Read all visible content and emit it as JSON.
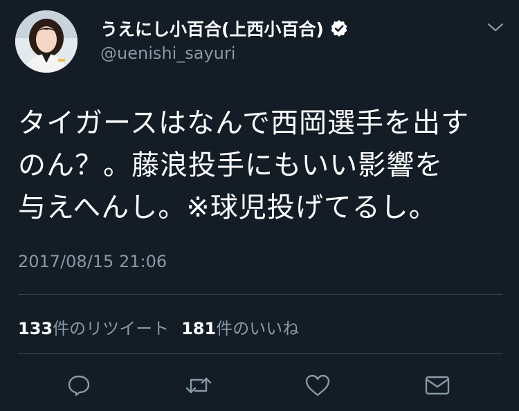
{
  "user": {
    "display_name": "うえにし小百合(上西小百合)",
    "handle": "@uenishi_sayuri",
    "verified": true
  },
  "tweet": {
    "text_lines": [
      "タイガースはなんで西岡選手を出す",
      "のん？。藤浪投手にもいい影響を",
      "与えへんし。※球児投げてるし。"
    ],
    "timestamp": "2017/08/15 21:06"
  },
  "stats": {
    "retweets_count": "133",
    "retweets_label": "件のリツイート",
    "likes_count": "181",
    "likes_label": "件のいいね"
  },
  "actions": [
    "reply-icon",
    "retweet-icon",
    "like-icon",
    "direct-message-icon"
  ],
  "colors": {
    "background": "#141d26",
    "secondary_text": "#8899a6",
    "divider": "#38444d",
    "verified_badge": "#ffffff"
  }
}
